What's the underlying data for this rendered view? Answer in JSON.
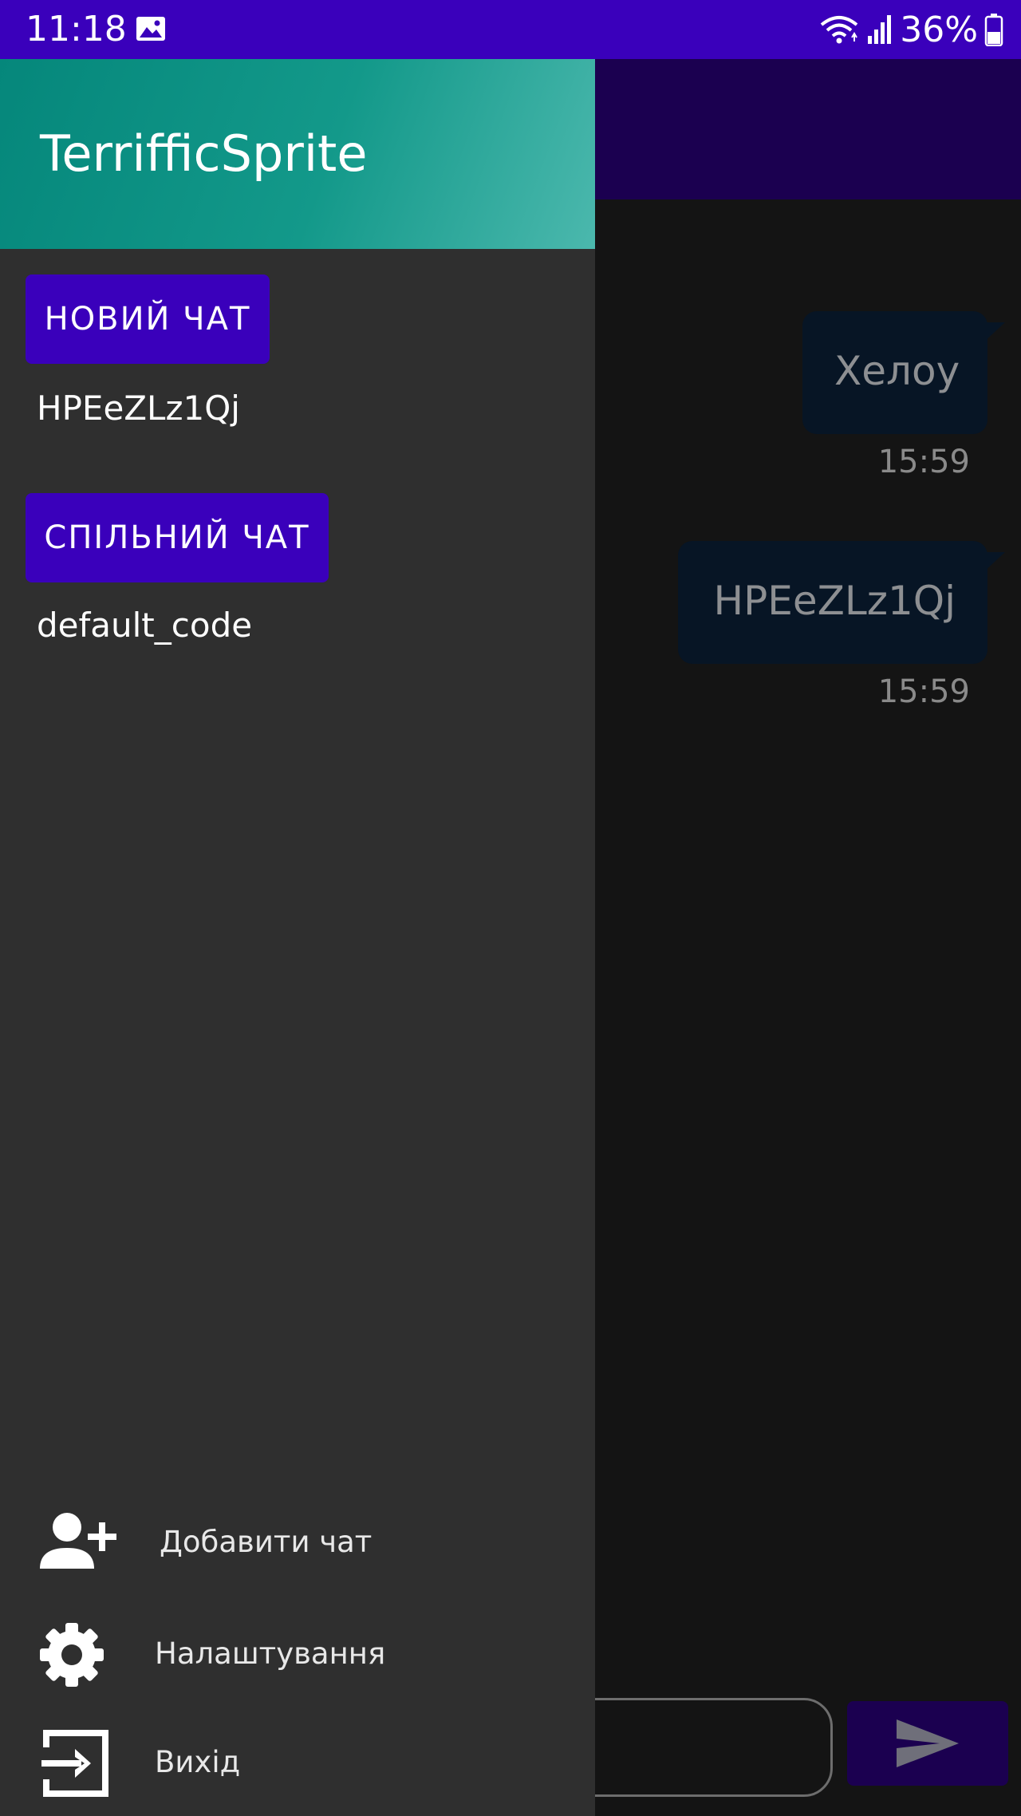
{
  "status_bar": {
    "time": "11:18",
    "battery": "36%",
    "icons": [
      "image-icon",
      "wifi-icon",
      "signal-icon",
      "battery-icon"
    ]
  },
  "drawer": {
    "title": "TerrifficSprite",
    "new_chat_button": "НОВИЙ ЧАТ",
    "new_chat_code": "HPEeZLz1Qj",
    "shared_chat_button": "СПІЛЬНИЙ ЧАТ",
    "shared_chat_code": "default_code",
    "menu": [
      {
        "label": "Добавити чат",
        "icon": "add-user-icon"
      },
      {
        "label": "Налаштування",
        "icon": "gear-icon"
      },
      {
        "label": "Вихід",
        "icon": "exit-icon"
      }
    ]
  },
  "chat": {
    "messages": [
      {
        "text": "Хелоу",
        "time": "15:59"
      },
      {
        "text": "HPEeZLz1Qj",
        "time": "15:59"
      }
    ],
    "send_icon": "send-icon"
  },
  "colors": {
    "primary": "#3a00bb",
    "primary_dark": "#1b0050",
    "drawer_bg": "#2f2f2f",
    "header_teal": "#05877b",
    "bubble_bg": "#071525"
  }
}
